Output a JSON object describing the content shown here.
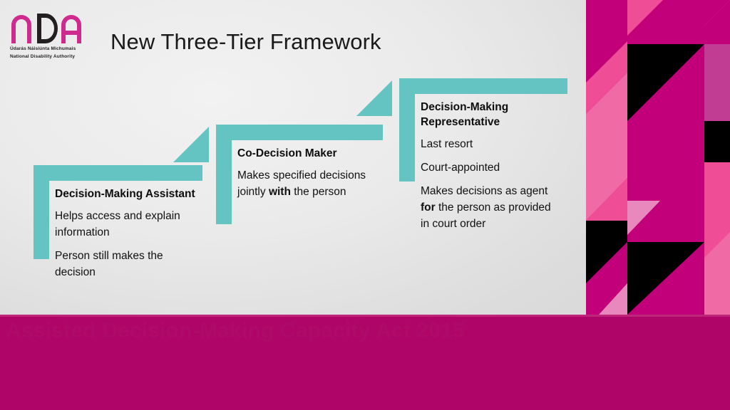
{
  "slide": {
    "title": "New Three-Tier Framework",
    "background_color": "#dcdcdc",
    "accent_teal": "#63c4c1",
    "accent_magenta": "#b00568",
    "band_ghost_text": "Assisted Decision-Making Capacity Act 2015"
  },
  "logo": {
    "wordmark": "nDA",
    "letter_n": "n",
    "letter_d": "D",
    "letter_a": "A",
    "irish_name": "Údarás Náisiúnta Michumais",
    "english_name": "National Disability Authority",
    "pink": "#cf2b8f",
    "dark": "#231f20"
  },
  "tiers": [
    {
      "id": "decision-making-assistant",
      "heading": "Decision-Making Assistant",
      "lines": [
        {
          "text": "Helps access and explain information",
          "bold_part": ""
        },
        {
          "text": "Person still makes the decision",
          "bold_part": ""
        }
      ]
    },
    {
      "id": "co-decision-maker",
      "heading": "Co-Decision Maker",
      "lines": [
        {
          "pre": "Makes specified decisions jointly ",
          "bold_part": "with",
          "post": " the person"
        }
      ]
    },
    {
      "id": "decision-making-representative",
      "heading": "Decision-Making Representative",
      "lines": [
        {
          "text": "Last resort",
          "bold_part": ""
        },
        {
          "text": "Court-appointed",
          "bold_part": ""
        },
        {
          "pre": "Makes decisions as agent ",
          "bold_part": "for",
          "post": " the person as provided in court order"
        }
      ]
    }
  ],
  "pattern": {
    "colors": {
      "magenta_deep": "#c2007a",
      "magenta_dark": "#a8106f",
      "pink_mid": "#ef4e97",
      "pink_light": "#f06ba6",
      "pink_pale": "#e888bd",
      "plum": "#c13c93",
      "black": "#000000"
    }
  }
}
